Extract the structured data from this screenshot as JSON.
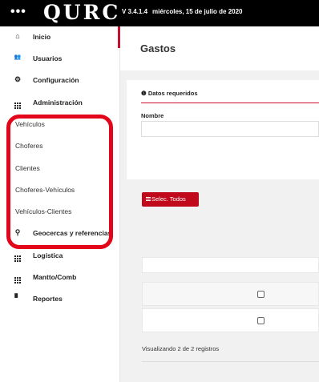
{
  "topbar": {
    "menu_icon": "ellipsis-icon",
    "menu_glyph": "•••",
    "logo": "QURC",
    "version": "V 3.4.1.4",
    "date": "miércoles, 15 de julio de 2020"
  },
  "sidebar": {
    "items": [
      {
        "label": "Inicio",
        "icon": "home-icon",
        "glyph": "⌂"
      },
      {
        "label": "Usuarios",
        "icon": "users-icon",
        "glyph": "👥"
      },
      {
        "label": "Configuración",
        "icon": "gear-icon",
        "glyph": "⚙"
      },
      {
        "label": "Administración",
        "icon": "grid-icon"
      },
      {
        "label": "Geocercas y referencias",
        "icon": "map-marker-icon",
        "glyph": "⚲"
      },
      {
        "label": "Logística",
        "icon": "grid-icon"
      },
      {
        "label": "Mantto/Comb",
        "icon": "grid-icon"
      },
      {
        "label": "Reportes",
        "icon": "document-icon",
        "glyph": "▘"
      }
    ],
    "sub_items": [
      {
        "label": "Vehículos"
      },
      {
        "label": "Choferes"
      },
      {
        "label": "Clientes"
      },
      {
        "label": "Choferes-Vehículos"
      },
      {
        "label": "Vehículos-Clientes"
      }
    ],
    "active_item": "Inicio",
    "highlight_color": "#e3061b"
  },
  "main": {
    "title": "Gastos",
    "required_label": "Datos requeridos",
    "name_label": "Nombre",
    "name_value": "",
    "select_all_label": "Selec. Todos",
    "table": {
      "rows": [
        {
          "checked": false
        },
        {
          "checked": false
        }
      ]
    },
    "footer": "Visualizando 2 de 2 registros"
  },
  "colors": {
    "accent": "#c0091b",
    "topbar": "#000000"
  }
}
